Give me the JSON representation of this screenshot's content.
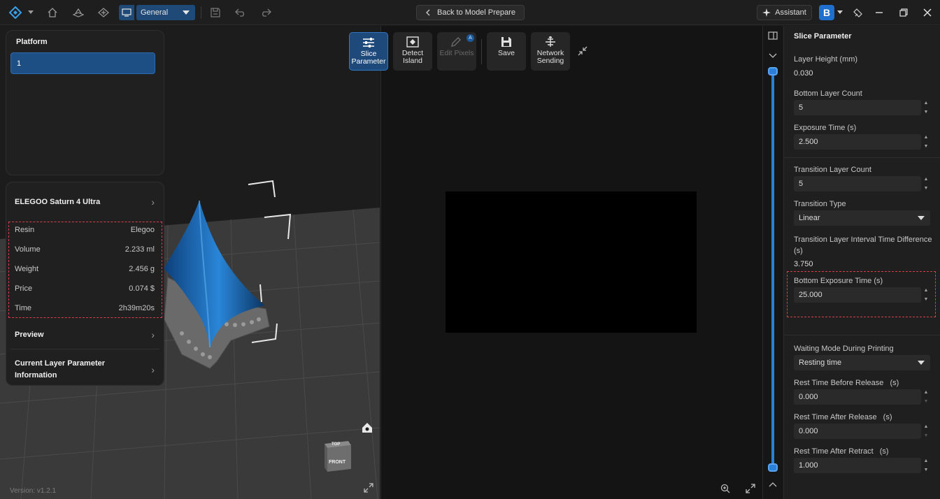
{
  "topbar": {
    "view_select": "General",
    "back_button": "Back to Model Prepare",
    "assistant_button": "Assistant",
    "logo_letter": "B"
  },
  "platform_panel": {
    "title": "Platform",
    "items": [
      "1"
    ]
  },
  "info_panel": {
    "printer": "ELEGOO Saturn 4 Ultra",
    "stats": [
      {
        "label": "Resin",
        "value": "Elegoo"
      },
      {
        "label": "Volume",
        "value": "2.233 ml"
      },
      {
        "label": "Weight",
        "value": "2.456 g"
      },
      {
        "label": "Price",
        "value": "0.074 $"
      },
      {
        "label": "Time",
        "value": "2h39m20s"
      }
    ],
    "preview": "Preview",
    "current_layer_line1": "Current Layer Parameter",
    "current_layer_line2": "Information"
  },
  "toolbar": {
    "slice_line1": "Slice",
    "slice_line2": "Parameter",
    "detect_line1": "Detect",
    "detect_line2": "Island",
    "edit_pixels": "Edit Pixels",
    "edit_badge": "A",
    "save": "Save",
    "network_line1": "Network",
    "network_line2": "Sending"
  },
  "viewcube": {
    "top": "TOP",
    "front": "FRONT"
  },
  "version": "Version: v1.2.1",
  "slice_parameter": {
    "title": "Slice Parameter",
    "layer_height_label": "Layer Height (mm)",
    "layer_height_value": "0.030",
    "bottom_layer_count_label": "Bottom Layer Count",
    "bottom_layer_count_value": "5",
    "exposure_time_label": "Exposure Time (s)",
    "exposure_time_value": "2.500",
    "transition_layer_count_label": "Transition Layer Count",
    "transition_layer_count_value": "5",
    "transition_type_label": "Transition Type",
    "transition_type_value": "Linear",
    "transition_interval_label_1": "Transition Layer Interval Time Difference",
    "transition_interval_label_2": "(s)",
    "transition_interval_value": "3.750",
    "bottom_exposure_label": "Bottom Exposure Time (s)",
    "bottom_exposure_value": "25.000",
    "waiting_mode_label": "Waiting Mode During Printing",
    "waiting_mode_value": "Resting time",
    "rest_before_label": "Rest Time Before Release",
    "rest_before_unit": "(s)",
    "rest_before_value": "0.000",
    "rest_after_label": "Rest Time After Release",
    "rest_after_unit": "(s)",
    "rest_after_value": "0.000",
    "rest_retract_label": "Rest Time After Retract",
    "rest_retract_unit": "(s)",
    "rest_retract_value": "1.000"
  }
}
